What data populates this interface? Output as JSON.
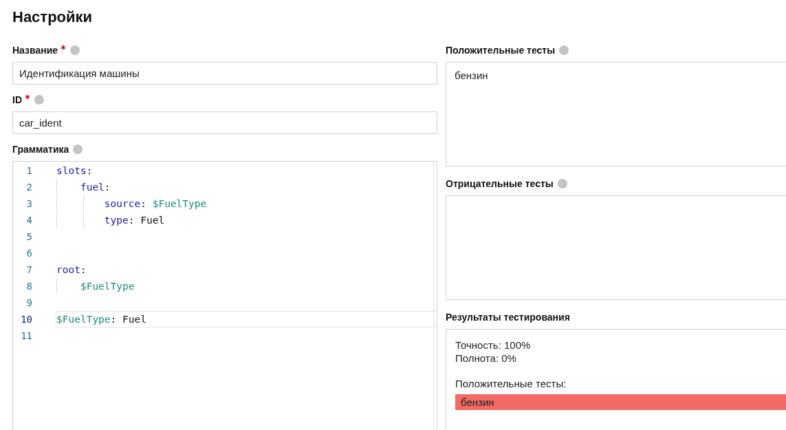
{
  "title": "Настройки",
  "left": {
    "fields": [
      {
        "label": "Название",
        "required": true,
        "value": "Идентификация машины"
      },
      {
        "label": "ID",
        "required": true,
        "value": "car_ident"
      }
    ],
    "grammar": {
      "label": "Грамматика",
      "lines": [
        {
          "number": "1",
          "current": false,
          "tokens": [
            {
              "kind": "key",
              "text": "slots"
            },
            {
              "kind": "plain",
              "text": ":"
            }
          ]
        },
        {
          "number": "2",
          "current": false,
          "tokens": [
            {
              "kind": "key",
              "text": "    fuel"
            },
            {
              "kind": "plain",
              "text": ":"
            }
          ]
        },
        {
          "number": "3",
          "current": false,
          "tokens": [
            {
              "kind": "key",
              "text": "        source"
            },
            {
              "kind": "plain",
              "text": ": "
            },
            {
              "kind": "var",
              "text": "$FuelType"
            }
          ]
        },
        {
          "number": "4",
          "current": false,
          "tokens": [
            {
              "kind": "key",
              "text": "        type"
            },
            {
              "kind": "plain",
              "text": ": Fuel"
            }
          ]
        },
        {
          "number": "5",
          "current": false
        },
        {
          "number": "6",
          "current": false
        },
        {
          "number": "7",
          "current": false,
          "tokens": [
            {
              "kind": "key",
              "text": "root"
            },
            {
              "kind": "plain",
              "text": ":"
            }
          ]
        },
        {
          "number": "8",
          "current": false,
          "tokens": [
            {
              "kind": "var",
              "text": "    $FuelType"
            }
          ]
        },
        {
          "number": "9",
          "current": false
        },
        {
          "number": "10",
          "current": true,
          "tokens": [
            {
              "kind": "var",
              "text": "$FuelType"
            },
            {
              "kind": "plain",
              "text": ": Fuel"
            }
          ]
        },
        {
          "number": "11",
          "current": false
        }
      ]
    }
  },
  "right": {
    "positive": {
      "label": "Положительные тесты",
      "value": "бензин"
    },
    "negative": {
      "label": "Отрицательные тесты"
    },
    "results": {
      "label": "Результаты тестирования",
      "precision": "Точность: 100%",
      "recall": "Полнота: 0%",
      "positive_label": "Положительные тесты:",
      "items": [
        {
          "text": "бензин",
          "passed": false
        }
      ]
    }
  }
}
